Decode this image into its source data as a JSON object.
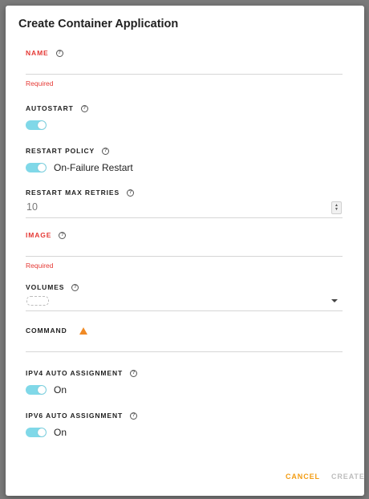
{
  "dialog": {
    "title": "Create Container Application",
    "name": {
      "label": "NAME",
      "error": "Required",
      "value": ""
    },
    "autostart": {
      "label": "AUTOSTART",
      "enabled": true
    },
    "restart_policy": {
      "label": "RESTART POLICY",
      "value": "On-Failure Restart",
      "enabled": true
    },
    "restart_max_retries": {
      "label": "RESTART MAX RETRIES",
      "value": "10"
    },
    "image": {
      "label": "IMAGE",
      "error": "Required",
      "value": ""
    },
    "volumes": {
      "label": "VOLUMES"
    },
    "command": {
      "label": "COMMAND",
      "value": ""
    },
    "ipv4": {
      "label": "IPV4 AUTO ASSIGNMENT",
      "value": "On",
      "enabled": true
    },
    "ipv6": {
      "label": "IPV6 AUTO ASSIGNMENT",
      "value": "On",
      "enabled": true
    },
    "buttons": {
      "cancel": "CANCEL",
      "create": "CREATE"
    }
  },
  "colors": {
    "error": "#e53935",
    "toggle_on": "#80d8e8",
    "accent": "#f39c12",
    "warning": "#f08a24",
    "disabled": "#bdbdbd"
  },
  "icons": {
    "help": "help-circle-icon",
    "warning": "warning-triangle-icon",
    "dropdown": "chevron-down-icon"
  }
}
